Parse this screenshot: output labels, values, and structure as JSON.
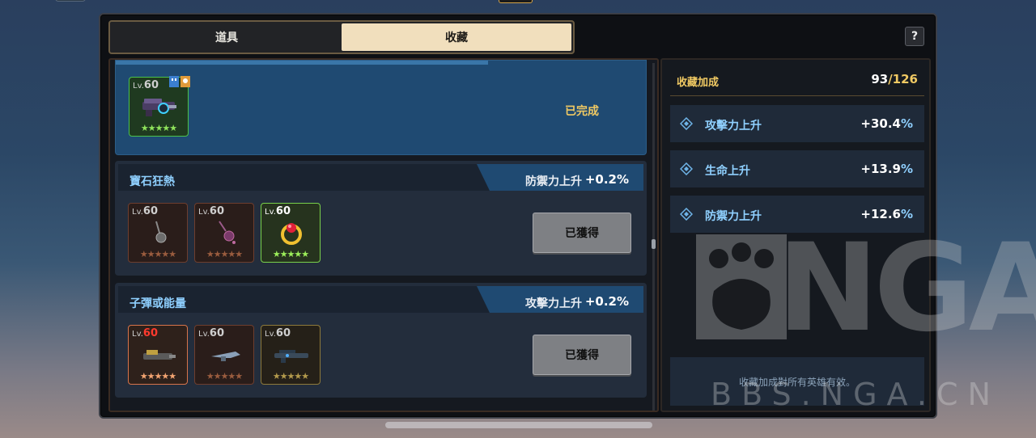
{
  "tabs": [
    {
      "label": "道具",
      "active": false
    },
    {
      "label": "收藏",
      "active": true
    }
  ],
  "help_label": "?",
  "featured_card": {
    "item": {
      "lv_prefix": "Lv.",
      "level": "60",
      "stars": "★★★★★",
      "rarity": "green"
    },
    "status": "已完成"
  },
  "collections": [
    {
      "name": "寶石狂熱",
      "bonus_label": "防禦力上升",
      "bonus_value": "+0.2%",
      "button": "已獲得",
      "items": [
        {
          "lv_prefix": "Lv.",
          "level": "60",
          "stars": "★★★★★",
          "rarity": "dark-brown",
          "icon": "pendant-icon"
        },
        {
          "lv_prefix": "Lv.",
          "level": "60",
          "stars": "★★★★★",
          "rarity": "dark-brown",
          "icon": "necklace-icon"
        },
        {
          "lv_prefix": "Lv.",
          "level": "60",
          "stars": "★★★★★",
          "rarity": "green",
          "icon": "ring-icon"
        }
      ]
    },
    {
      "name": "子彈或能量",
      "bonus_label": "攻擊力上升",
      "bonus_value": "+0.2%",
      "button": "已獲得",
      "items": [
        {
          "lv_prefix": "Lv.",
          "level": "60",
          "stars": "★★★★★",
          "rarity": "orange",
          "icon": "gatling-icon"
        },
        {
          "lv_prefix": "Lv.",
          "level": "60",
          "stars": "★★★★★",
          "rarity": "dark-brown",
          "icon": "pistol-icon"
        },
        {
          "lv_prefix": "Lv.",
          "level": "60",
          "stars": "★★★★★",
          "rarity": "gold",
          "icon": "rifle-icon"
        }
      ]
    }
  ],
  "collection_bonus": {
    "title": "收藏加成",
    "count": "93",
    "total": "/126",
    "stats": [
      {
        "label": "攻擊力上升",
        "value": "+30.4",
        "unit": "%"
      },
      {
        "label": "生命上升",
        "value": "+13.9",
        "unit": "%"
      },
      {
        "label": "防禦力上升",
        "value": "+12.6",
        "unit": "%"
      }
    ],
    "footer": "收藏加成對所有英雄有效。"
  },
  "watermark": {
    "logo": "NGA",
    "url": "BBS.NGA.CN"
  },
  "colors": {
    "accent_gold": "#f0c963",
    "accent_blue": "#8fd0ff",
    "panel_blue": "#1f4a72"
  }
}
